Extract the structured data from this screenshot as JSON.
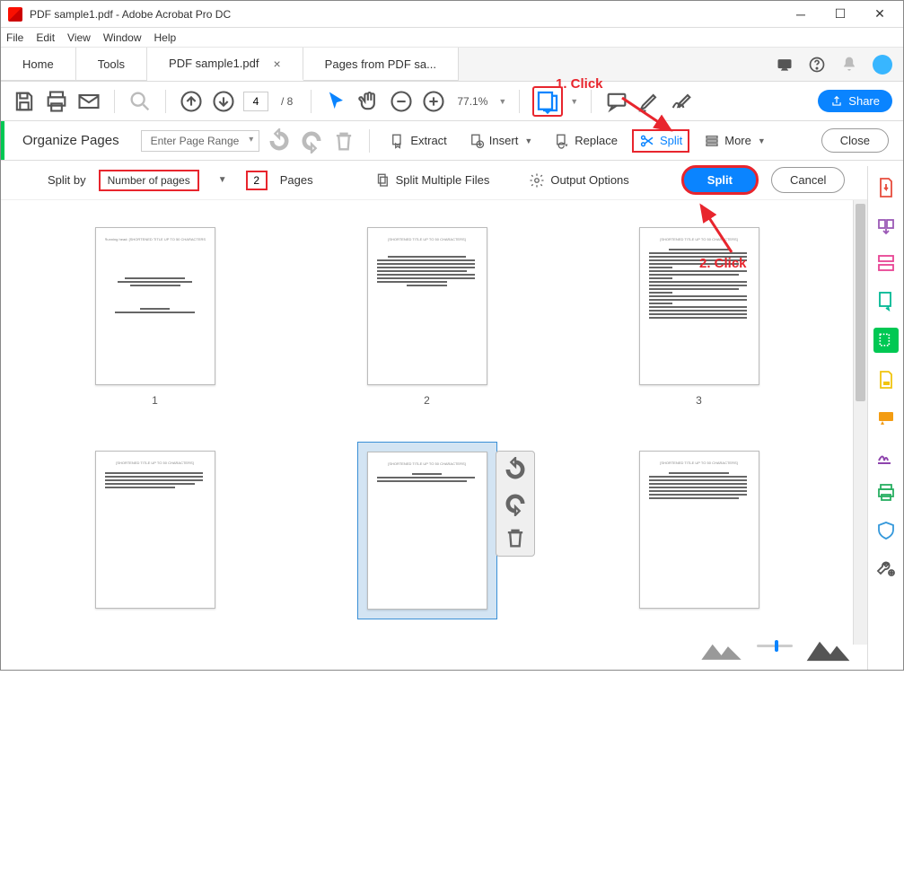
{
  "window": {
    "title": "PDF sample1.pdf - Adobe Acrobat Pro DC"
  },
  "menu": {
    "file": "File",
    "edit": "Edit",
    "view": "View",
    "window": "Window",
    "help": "Help"
  },
  "tabs": {
    "home": "Home",
    "tools": "Tools",
    "doc1": "PDF sample1.pdf",
    "doc2": "Pages from PDF sa..."
  },
  "toolbar": {
    "page_current": "4",
    "page_total": "/ 8",
    "zoom": "77.1%",
    "share": "Share"
  },
  "organize": {
    "title": "Organize Pages",
    "range": "Enter Page Range",
    "extract": "Extract",
    "insert": "Insert",
    "replace": "Replace",
    "split": "Split",
    "more": "More",
    "close": "Close"
  },
  "split": {
    "label": "Split by",
    "method": "Number of pages",
    "value": "2",
    "pages": "Pages",
    "multi": "Split Multiple Files",
    "options": "Output Options",
    "go": "Split",
    "cancel": "Cancel"
  },
  "thumbs": {
    "p1": "1",
    "p2": "2",
    "p3": "3"
  },
  "anno": {
    "a1": "1. Click",
    "a2": "2. Click"
  }
}
